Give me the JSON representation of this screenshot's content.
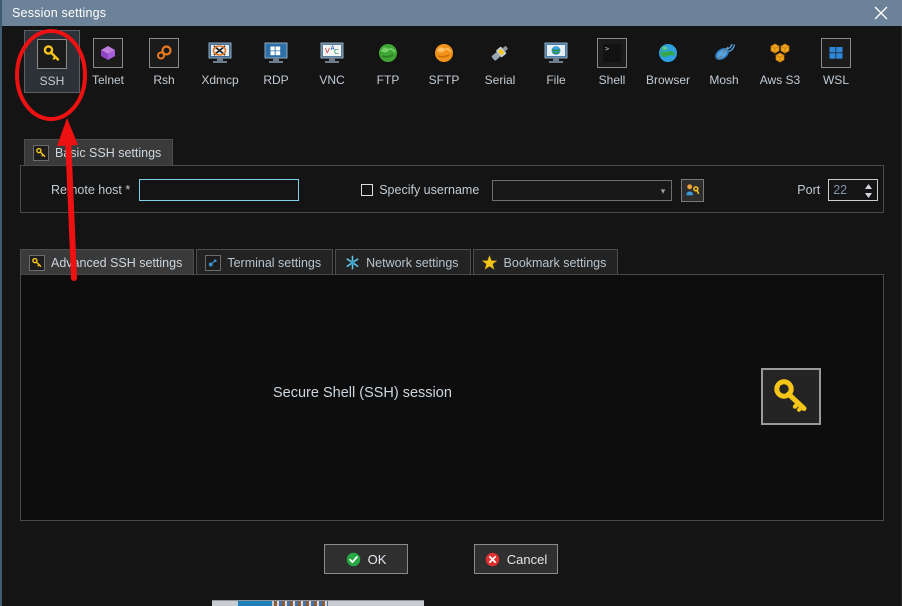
{
  "window": {
    "title": "Session settings",
    "close_label": "×",
    "titlebar_color": "#6c8299"
  },
  "session_types": [
    {
      "label": "SSH",
      "icon": "key-icon",
      "selected": true
    },
    {
      "label": "Telnet",
      "icon": "purple-cube-icon",
      "selected": false
    },
    {
      "label": "Rsh",
      "icon": "orange-gears-icon",
      "selected": false
    },
    {
      "label": "Xdmcp",
      "icon": "monitor-x-icon",
      "selected": false
    },
    {
      "label": "RDP",
      "icon": "monitor-windows-icon",
      "selected": false
    },
    {
      "label": "VNC",
      "icon": "monitor-vnc-icon",
      "selected": false
    },
    {
      "label": "FTP",
      "icon": "green-globe-icon",
      "selected": false
    },
    {
      "label": "SFTP",
      "icon": "orange-globe-icon",
      "selected": false
    },
    {
      "label": "Serial",
      "icon": "serial-plug-icon",
      "selected": false
    },
    {
      "label": "File",
      "icon": "monitor-globe-icon",
      "selected": false
    },
    {
      "label": "Shell",
      "icon": "console-prompt-icon",
      "selected": false
    },
    {
      "label": "Browser",
      "icon": "blue-globe-icon",
      "selected": false
    },
    {
      "label": "Mosh",
      "icon": "satellite-dish-icon",
      "selected": false
    },
    {
      "label": "Aws S3",
      "icon": "orange-cubes-icon",
      "selected": false
    },
    {
      "label": "WSL",
      "icon": "windows-logo-icon",
      "selected": false
    }
  ],
  "basic_panel": {
    "tab_label": "Basic SSH settings",
    "tab_icon": "key-icon",
    "remote_host_label": "Remote host *",
    "remote_host_value": "",
    "specify_username_label": "Specify username",
    "specify_username_checked": false,
    "username_value": "",
    "username_button_icon": "user-key-icon",
    "port_label": "Port",
    "port_value": "22"
  },
  "lower_tabs": [
    {
      "label": "Advanced SSH settings",
      "icon": "key-icon",
      "active": true
    },
    {
      "label": "Terminal settings",
      "icon": "terminal-icon",
      "active": false
    },
    {
      "label": "Network settings",
      "icon": "network-star-icon",
      "active": false
    },
    {
      "label": "Bookmark settings",
      "icon": "yellow-star-icon",
      "active": false
    }
  ],
  "content": {
    "session_description": "Secure Shell (SSH) session",
    "session_icon": "large-key-icon"
  },
  "footer": {
    "ok_label": "OK",
    "ok_icon": "green-check-icon",
    "cancel_label": "Cancel",
    "cancel_icon": "red-cross-icon"
  },
  "annotation": {
    "color": "#ee1111",
    "shapes": "ellipse-around-ssh-and-up-arrow"
  }
}
